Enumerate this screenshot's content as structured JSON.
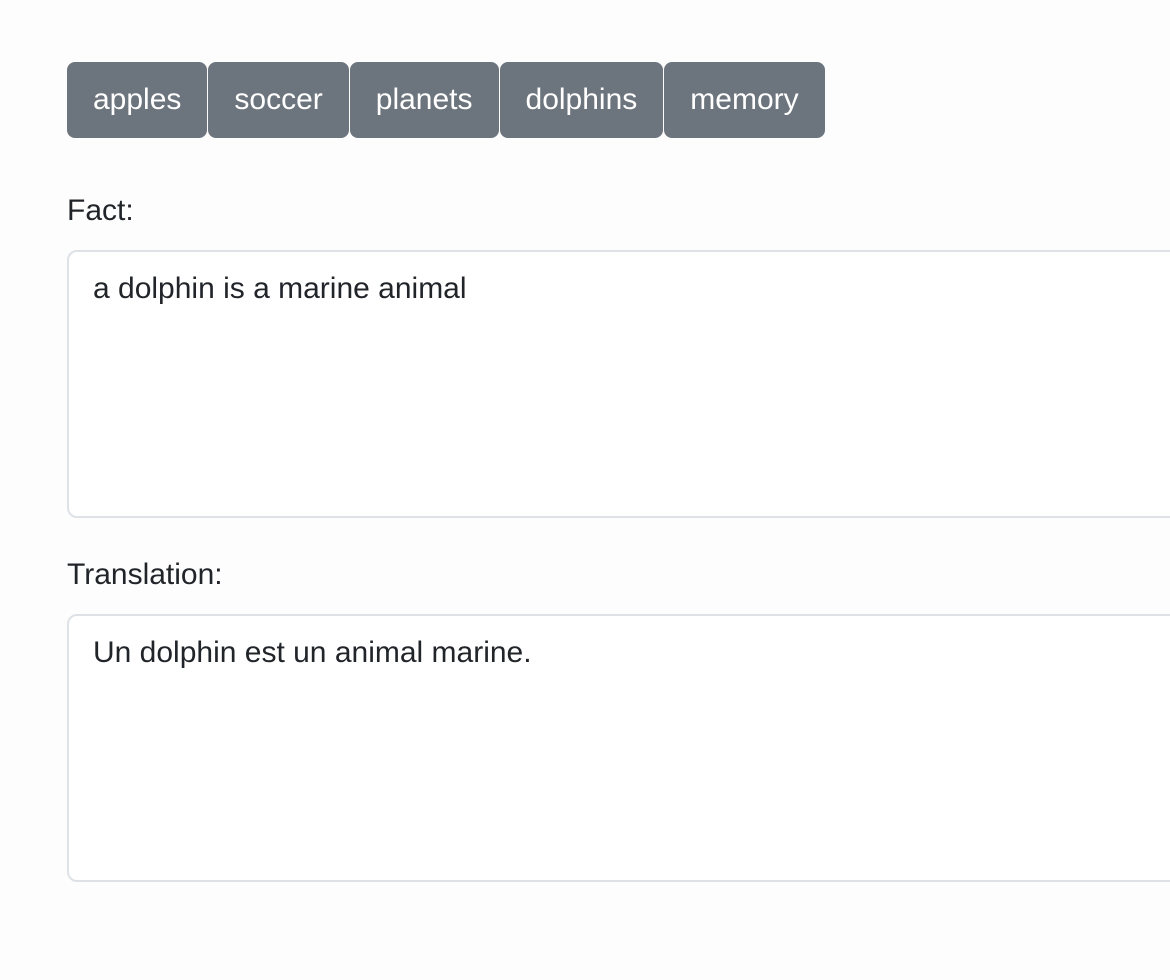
{
  "topics": [
    {
      "label": "apples"
    },
    {
      "label": "soccer"
    },
    {
      "label": "planets"
    },
    {
      "label": "dolphins"
    },
    {
      "label": "memory"
    }
  ],
  "fact": {
    "label": "Fact:",
    "value": "a dolphin is a marine animal"
  },
  "translation": {
    "label": "Translation:",
    "value": "Un dolphin est un animal marine."
  },
  "colors": {
    "button_bg": "#6c757d",
    "button_text": "#ffffff",
    "text": "#212529",
    "border": "#dee2e6"
  }
}
